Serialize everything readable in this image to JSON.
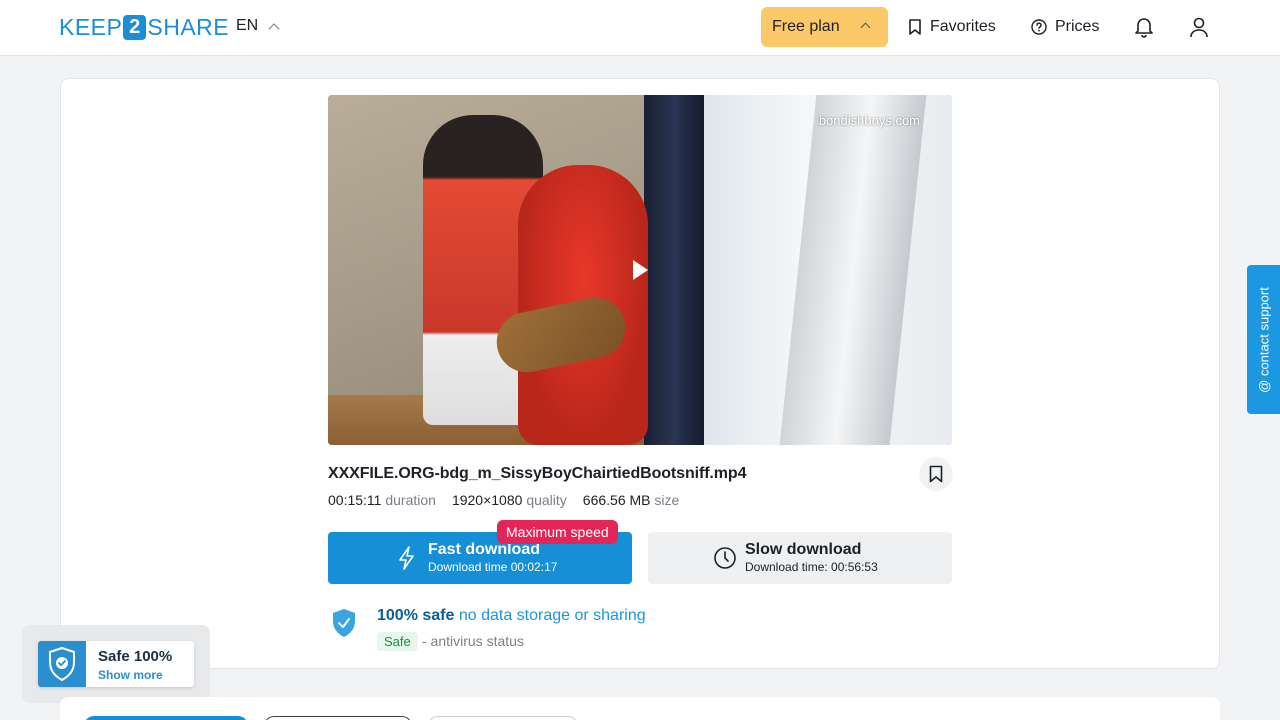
{
  "header": {
    "logo": {
      "left": "KEEP",
      "mid": "2",
      "right": "SHARE"
    },
    "language": "EN",
    "free_plan_label": "Free plan",
    "favorites_label": "Favorites",
    "prices_label": "Prices"
  },
  "video": {
    "watermark": "bondishboys.com"
  },
  "file": {
    "name": "XXXFILE.ORG-bdg_m_SissyBoyChairtiedBootsniff.mp4",
    "duration": "00:15:11",
    "duration_label": "duration",
    "quality": "1920×1080",
    "quality_label": "quality",
    "size": "666.56 MB",
    "size_label": "size"
  },
  "download": {
    "max_speed_badge": "Maximum speed",
    "fast_label": "Fast download",
    "fast_time": "Download time 00:02:17",
    "slow_label": "Slow download",
    "slow_time": "Download time: 00:56:53"
  },
  "safety": {
    "title_bold": "100% safe",
    "title_rest": "no data storage or sharing",
    "status_pill": "Safe",
    "status_text": "- antivirus status"
  },
  "support_label": "@ contact support",
  "safe_widget": {
    "title": "Safe 100%",
    "link": "Show more"
  },
  "colors": {
    "accent": "#1590d6",
    "free_plan": "#fbc96a",
    "badge": "#e2265a",
    "safe_green": "#1f8a43"
  }
}
